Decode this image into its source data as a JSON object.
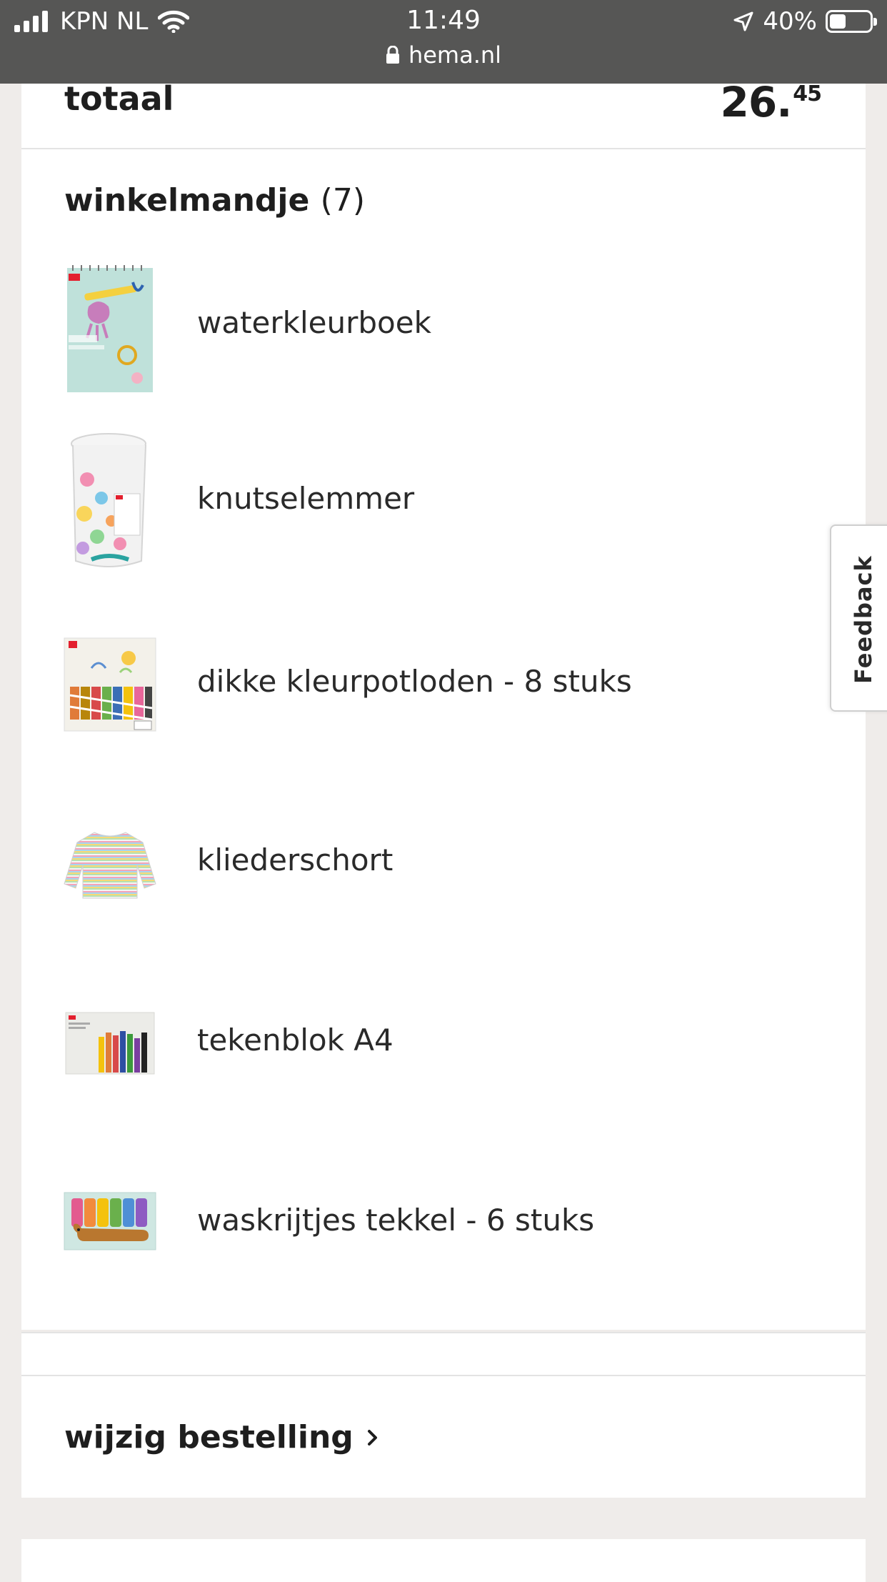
{
  "status_bar": {
    "carrier": "KPN NL",
    "time": "11:49",
    "domain": "hema.nl",
    "battery": "40%",
    "battery_level": 0.4
  },
  "order": {
    "total_label": "totaal",
    "total_whole": "26.",
    "total_cents": "45"
  },
  "basket": {
    "title": "winkelmandje",
    "count": "(7)",
    "items": [
      {
        "name": "waterkleurboek",
        "image": "watercolor-book-image"
      },
      {
        "name": "knutselemmer",
        "image": "craft-bucket-image"
      },
      {
        "name": "dikke kleurpotloden - 8 stuks",
        "image": "thick-colored-pencils-image"
      },
      {
        "name": "kliederschort",
        "image": "art-smock-image"
      },
      {
        "name": "tekenblok A4",
        "image": "drawing-pad-image"
      },
      {
        "name": "waskrijtjes tekkel - 6 stuks",
        "image": "dachshund-crayons-image"
      }
    ]
  },
  "change_order": {
    "label": "wijzig bestelling"
  },
  "feedback": {
    "label": "Feedback"
  },
  "colors": {
    "status_bar": "#565655",
    "page_background": "#efecea",
    "card": "#ffffff",
    "text": "#1e1e1e"
  }
}
